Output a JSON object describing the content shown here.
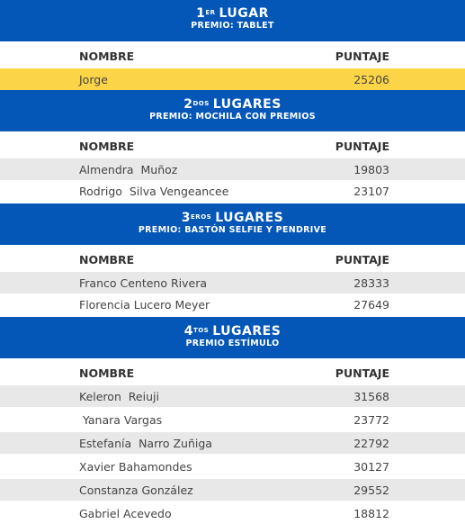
{
  "sections": [
    {
      "place_num": "1",
      "place_sup": "ER",
      "place_word": "LUGAR",
      "prize": "PREMIO: TABLET",
      "col_name": "NOMBRE",
      "col_score": "PUNTAJE",
      "rows": [
        {
          "name": "Jorge",
          "score": "25206"
        }
      ]
    },
    {
      "place_num": "2",
      "place_sup": "DOS",
      "place_word": "LUGARES",
      "prize": "PREMIO: MOCHILA CON PREMIOS",
      "col_name": "NOMBRE",
      "col_score": "PUNTAJE",
      "rows": [
        {
          "name": "Almendra  Muñoz",
          "score": "19803"
        },
        {
          "name": "Rodrigo  Silva Vengeancee",
          "score": "23107"
        }
      ]
    },
    {
      "place_num": "3",
      "place_sup": "EROS",
      "place_word": "LUGARES",
      "prize": "PREMIO: BASTÓN SELFIE Y PENDRIVE",
      "col_name": "NOMBRE",
      "col_score": "PUNTAJE",
      "rows": [
        {
          "name": "Franco Centeno Rivera",
          "score": "28333"
        },
        {
          "name": "Florencia Lucero Meyer",
          "score": "27649"
        }
      ]
    },
    {
      "place_num": "4",
      "place_sup": "TOS",
      "place_word": "LUGARES",
      "prize": "PREMIO ESTÍMULO",
      "col_name": "NOMBRE",
      "col_score": "PUNTAJE",
      "rows": [
        {
          "name": "Keleron  Reiuji",
          "score": "31568"
        },
        {
          "name": " Yanara Vargas",
          "score": "23772"
        },
        {
          "name": "Estefanía  Narro Zuñiga",
          "score": "22792"
        },
        {
          "name": "Xavier Bahamondes",
          "score": "30127"
        },
        {
          "name": "Constanza González",
          "score": "29552"
        },
        {
          "name": "Gabriel Acevedo",
          "score": "18812"
        }
      ]
    }
  ],
  "colors": {
    "banner_blue": "#0457b7",
    "winner_gold": "#fbd547",
    "row_gray": "#e8e8e8"
  }
}
